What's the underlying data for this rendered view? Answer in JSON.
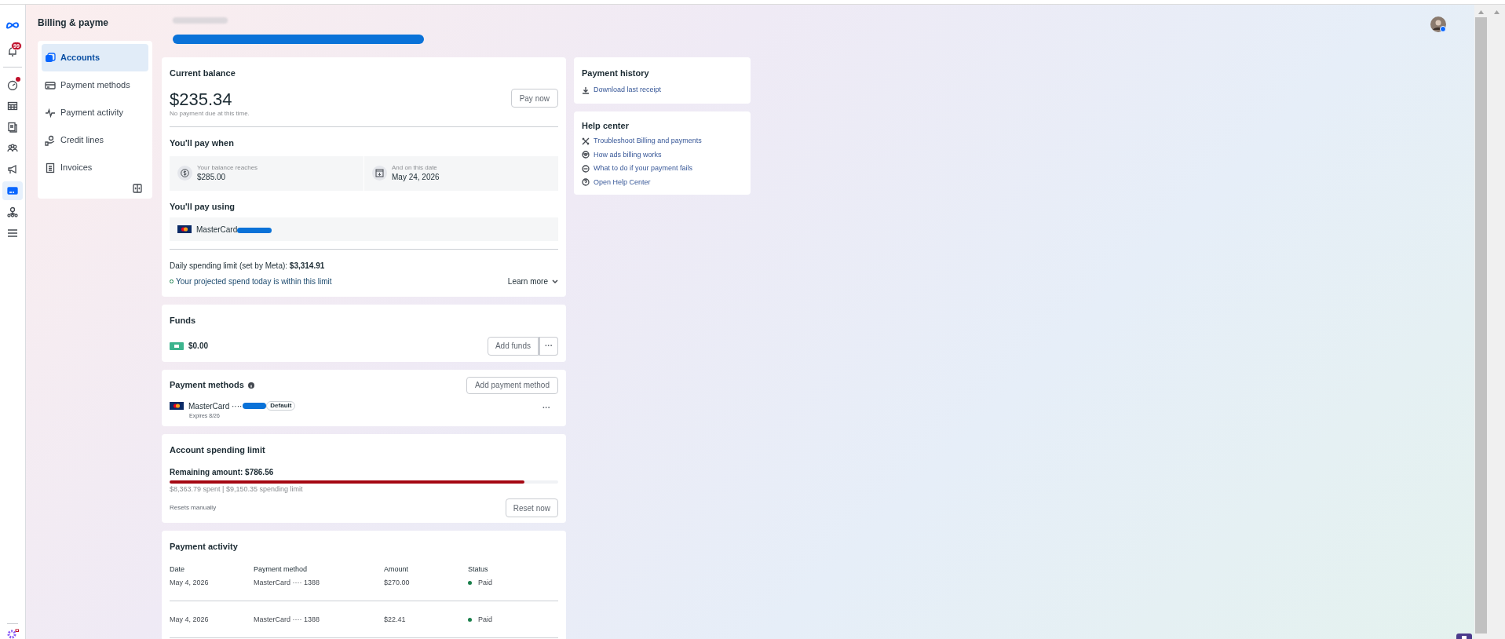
{
  "rail": {
    "notification_count": "99",
    "items": [
      {
        "selected": false,
        "alert": true
      },
      {
        "selected": false,
        "alert": false
      },
      {
        "selected": false,
        "alert": false
      },
      {
        "selected": false,
        "alert": false
      },
      {
        "selected": false,
        "alert": false
      },
      {
        "selected": true,
        "alert": false
      },
      {
        "selected": false,
        "alert": false
      },
      {
        "selected": false,
        "alert": false
      }
    ]
  },
  "sidebar": {
    "title": "Billing & payme",
    "items": [
      {
        "label": "Accounts",
        "selected": true
      },
      {
        "label": "Payment methods",
        "selected": false
      },
      {
        "label": "Payment activity",
        "selected": false
      },
      {
        "label": "Credit lines",
        "selected": false
      },
      {
        "label": "Invoices",
        "selected": false
      }
    ]
  },
  "current_balance": {
    "title": "Current balance",
    "amount": "$235.34",
    "note": "No payment due at this time.",
    "pay_button": "Pay now",
    "pay_when_title": "You'll pay when",
    "thresholds": [
      {
        "label": "Your balance reaches",
        "value": "$285.00"
      },
      {
        "label": "And on this date",
        "value": "May 24, 2026"
      }
    ],
    "pay_using_title": "You'll pay using",
    "card": "MasterCard",
    "daily_limit": "Daily spending limit (set by Meta): **$3,314.91**",
    "projection": "Your projected spend today is within this limit",
    "learn_more": "Learn more"
  },
  "funds": {
    "title": "Funds",
    "amount": "$0.00",
    "add_button": "Add funds",
    "more_button": "···"
  },
  "payment_methods": {
    "title": "Payment methods",
    "add_button": "Add payment method",
    "items": [
      {
        "card": "MasterCard ····",
        "badge": "Default",
        "expires": "Expires 8/26",
        "more": "···"
      }
    ]
  },
  "spending_limit": {
    "title": "Account spending limit",
    "remaining": "Remaining amount: $786.56",
    "level": 0.914,
    "summary": "$8,363.79 spent | $9,150.35 spending limit",
    "reset_note": "Resets manually",
    "reset_button": "Reset now"
  },
  "payment_activity": {
    "title": "Payment activity",
    "columns": [
      "Date",
      "Payment method",
      "Amount",
      "Status"
    ],
    "rows": [
      {
        "date": "May 4, 2026",
        "method": "MasterCard ···· 1388",
        "amount": "$270.00",
        "status": "Paid",
        "color": "#1a7f4b"
      },
      {
        "date": "May 4, 2026",
        "method": "MasterCard ···· 1388",
        "amount": "$22.41",
        "status": "Paid",
        "color": "#1a7f4b"
      }
    ]
  },
  "payment_history": {
    "title": "Payment history",
    "links": [
      "Download last receipt"
    ]
  },
  "help_center": {
    "title": "Help center",
    "links": [
      "Troubleshoot Billing and payments",
      "How ads billing works",
      "What to do if your payment fails",
      "Open Help Center"
    ]
  }
}
